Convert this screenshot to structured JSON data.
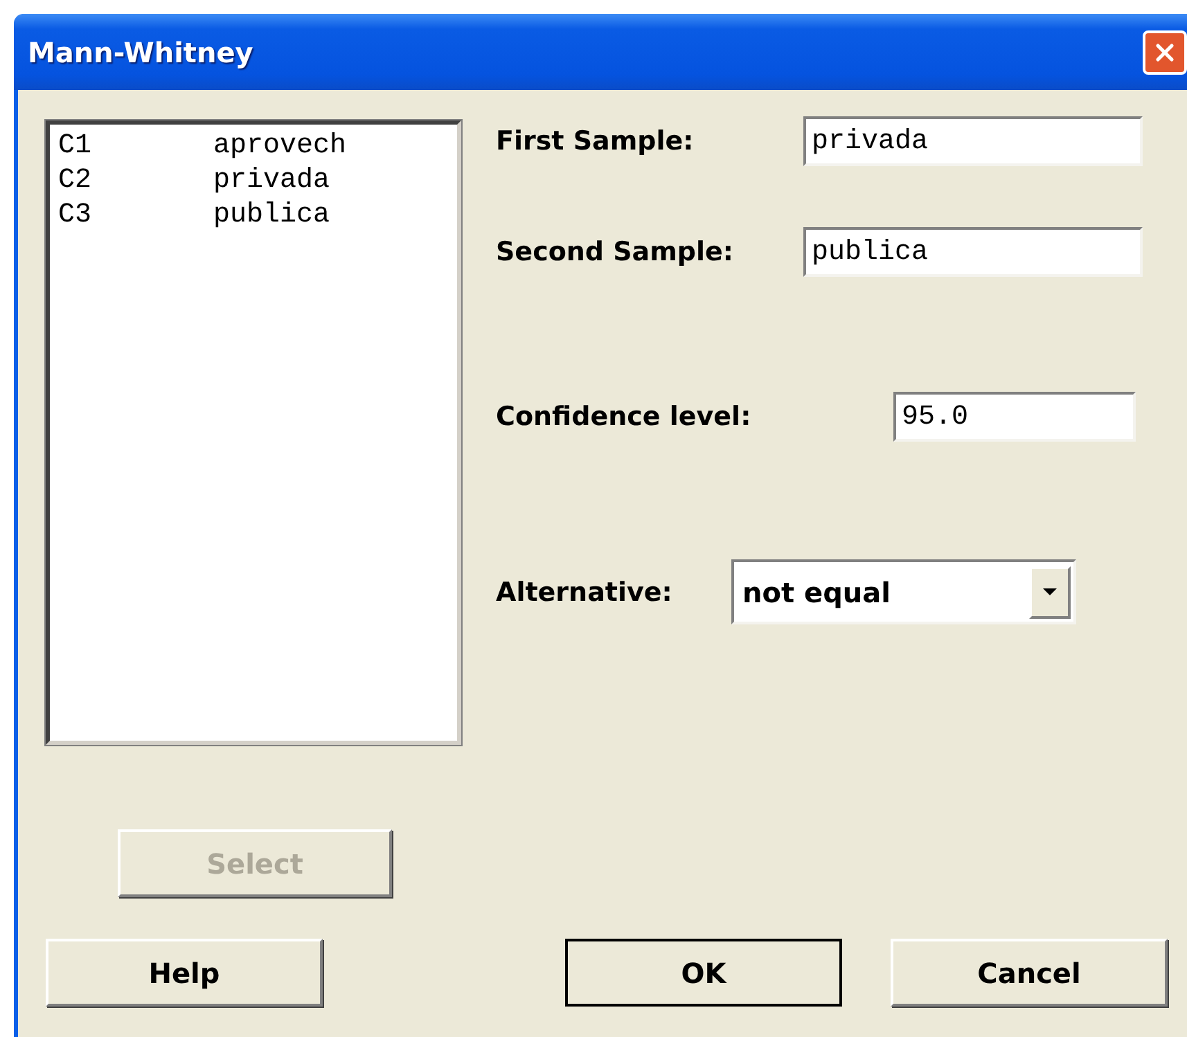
{
  "window": {
    "title": "Mann-Whitney"
  },
  "columns": [
    {
      "id": "C1",
      "name": "aprovech"
    },
    {
      "id": "C2",
      "name": "privada"
    },
    {
      "id": "C3",
      "name": "publica"
    }
  ],
  "samples": [
    {
      "label": "First Sample:",
      "value": "privada"
    },
    {
      "label": "Second Sample:",
      "value": "publica"
    }
  ],
  "confidence": {
    "label": "Confidence level:",
    "value": "95.0"
  },
  "alternative": {
    "label": "Alternative:",
    "value": "not equal"
  },
  "select_button": {
    "label": "Select",
    "disabled": true
  },
  "buttons": [
    {
      "label": "Help",
      "default": false
    },
    {
      "label": "OK",
      "default": true
    },
    {
      "label": "Cancel",
      "default": false
    }
  ]
}
